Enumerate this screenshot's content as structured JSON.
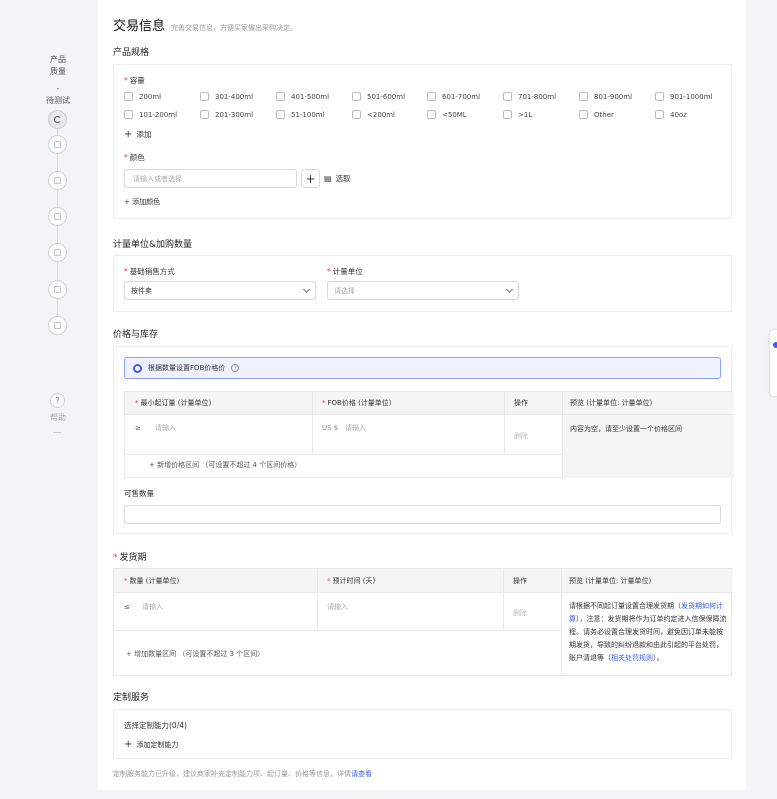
{
  "rail": {
    "label_line1": "产品",
    "label_line2": "质量",
    "dash": "-",
    "tag": "待测试",
    "help_icon": "question-circle-icon",
    "help_label": "帮助"
  },
  "header": {
    "title": "交易信息",
    "subtitle": "完善交易信息，方便买家做出采购决定。"
  },
  "spec": {
    "title": "产品规格",
    "capacity_label": "容量",
    "capacity_options": [
      "200ml",
      "301-400ml",
      "401-500ml",
      "501-600ml",
      "601-700ml",
      "701-800ml",
      "801-900ml",
      "901-1000ml",
      "101-200ml",
      "201-300ml",
      "51-100ml",
      "<200ml",
      "<50ML",
      ">1L",
      "Other",
      "40oz"
    ],
    "add_label": "添加",
    "color_label": "颜色",
    "color_placeholder": "请输入或者选择",
    "pick_label": "选取",
    "add_color_label": "+ 添加颜色"
  },
  "unit": {
    "title": "计量单位&加购数量",
    "sale_method_label": "基础销售方式",
    "sale_method_value": "按件卖",
    "unit_label": "计量单位",
    "unit_placeholder": "请选择"
  },
  "price": {
    "title": "价格与库存",
    "radio_label": "根据数量设置FOB价格价",
    "col_min_order": "最小起订量 (计量单位)",
    "col_fob": "FOB价格 (计量单位)",
    "col_action": "操作",
    "col_preview": "预览 (计量单位: 计量单位)",
    "ge_symbol": "≥",
    "min_order_placeholder": "请输入",
    "currency": "US $",
    "fob_placeholder": "请输入",
    "delete_label": "删除",
    "preview_empty": "内容为空，请至少设置一个价格区间",
    "add_price_tier": "+ 新增价格区间 （可设置不超过 4 个区间价格）",
    "stock_label": "可售数量"
  },
  "delivery": {
    "title": "发货期",
    "col_qty": "数量 (计量单位)",
    "col_time": "预计时间 (天)",
    "col_action": "操作",
    "col_preview": "预览 (计量单位: 计量单位)",
    "le_symbol": "≤",
    "qty_placeholder": "请输入",
    "time_placeholder": "请输入",
    "delete_label": "删除",
    "note_part1": "请根据不同起订量设置合理发货期（",
    "note_link1": "发货期如何计算",
    "note_part2": "），注意：发货期将作为订单约定进入信保保障流程。请务必设置合理发货时间，避免因订单未能按期发货，导致的纠纷退款和由此引起的平台处罚，账户清退等（",
    "note_link2": "相关处罚规则",
    "note_part3": "）。",
    "add_qty_tier": "+ 增加数量区间 （可设置不超过 3 个区间）"
  },
  "custom": {
    "title": "定制服务",
    "select_label": "选择定制能力(0/4)",
    "add_label": "添加定制能力"
  },
  "footer": {
    "text": "定制服务能力已升级，建议商家补充定制能力项、起订量、价格等信息，详情",
    "link": "请查看"
  }
}
